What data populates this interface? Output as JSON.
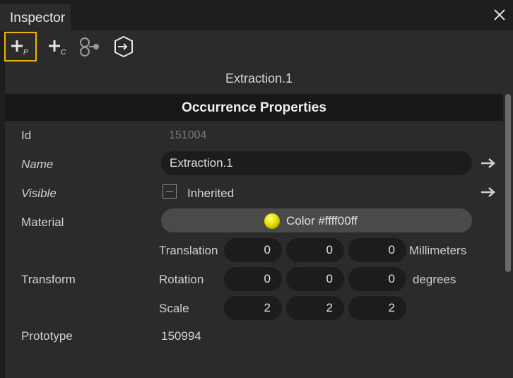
{
  "tab": {
    "title": "Inspector"
  },
  "toolbar": {
    "add_property_label": "+",
    "add_property_sub": "P",
    "add_component_label": "+",
    "add_component_sub": "C"
  },
  "object_name": "Extraction.1",
  "section": {
    "title": "Occurrence Properties"
  },
  "properties": {
    "id": {
      "label": "Id",
      "value": "151004"
    },
    "name": {
      "label": "Name",
      "value": "Extraction.1"
    },
    "visible": {
      "label": "Visible",
      "value": "Inherited"
    },
    "material": {
      "label": "Material",
      "value": "Color #ffff00ff",
      "swatch_color": "#e8e000"
    },
    "transform": {
      "label": "Transform",
      "translation": {
        "label": "Translation",
        "values": [
          "0",
          "0",
          "0"
        ],
        "unit": "Millimeters"
      },
      "rotation": {
        "label": "Rotation",
        "values": [
          "0",
          "0",
          "0"
        ],
        "unit": "degrees"
      },
      "scale": {
        "label": "Scale",
        "values": [
          "2",
          "2",
          "2"
        ]
      }
    },
    "prototype": {
      "label": "Prototype",
      "value": "150994"
    }
  },
  "colors": {
    "active_outline": "#f0b400",
    "panel_bg": "#2b2b2b",
    "field_bg": "#1c1c1c"
  }
}
